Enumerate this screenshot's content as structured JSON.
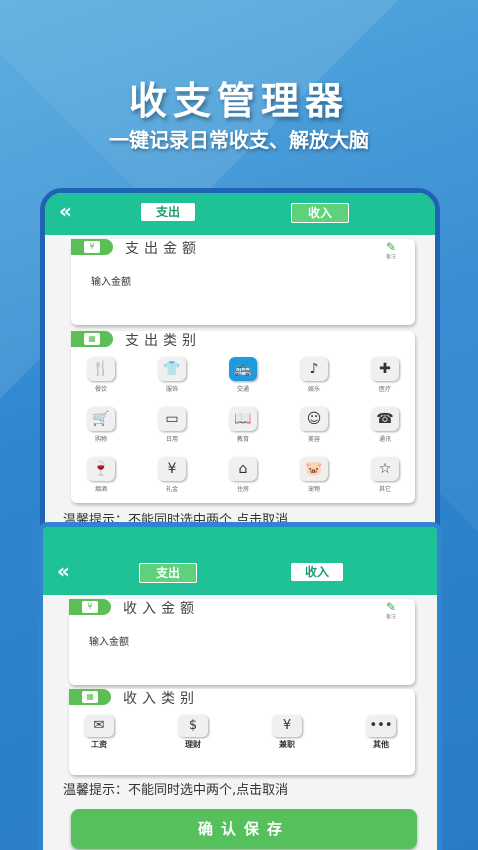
{
  "hero": {
    "title": "收支管理器",
    "subtitle": "一键记录日常收支、解放大脑"
  },
  "screen1": {
    "back": "«",
    "tabs": {
      "expense": "支出",
      "income": "收入"
    },
    "amount_title": "支出金额",
    "note_label": "备注",
    "amount_placeholder": "输入金额",
    "category_title": "支出类别",
    "categories": [
      {
        "label": "餐饮",
        "icon": "utensils-icon",
        "glyph": "🍴"
      },
      {
        "label": "服饰",
        "icon": "shirt-icon",
        "glyph": "👕"
      },
      {
        "label": "交通",
        "icon": "bus-icon",
        "glyph": "🚌",
        "active": true
      },
      {
        "label": "娱乐",
        "icon": "music-icon",
        "glyph": "♪"
      },
      {
        "label": "医疗",
        "icon": "medkit-icon",
        "glyph": "✚"
      },
      {
        "label": "购物",
        "icon": "cart-icon",
        "glyph": "🛒"
      },
      {
        "label": "日用",
        "icon": "sofa-icon",
        "glyph": "▭"
      },
      {
        "label": "教育",
        "icon": "book-icon",
        "glyph": "📖"
      },
      {
        "label": "美容",
        "icon": "face-icon",
        "glyph": "☺"
      },
      {
        "label": "通讯",
        "icon": "phone-icon",
        "glyph": "☎"
      },
      {
        "label": "烟酒",
        "icon": "bottle-icon",
        "glyph": "🍷"
      },
      {
        "label": "礼金",
        "icon": "moneybag-icon",
        "glyph": "¥"
      },
      {
        "label": "住房",
        "icon": "house-icon",
        "glyph": "⌂"
      },
      {
        "label": "宠物",
        "icon": "pet-icon",
        "glyph": "🐷"
      },
      {
        "label": "其它",
        "icon": "star-icon",
        "glyph": "☆"
      }
    ],
    "tip": "温馨提示：不能同时选中两个,点击取消"
  },
  "screen2": {
    "back": "«",
    "tabs": {
      "expense": "支出",
      "income": "收入"
    },
    "amount_title": "收入金额",
    "note_label": "备注",
    "amount_placeholder": "输入金额",
    "category_title": "收入类别",
    "categories": [
      {
        "label": "工资",
        "icon": "wallet-icon",
        "glyph": "✉"
      },
      {
        "label": "理财",
        "icon": "hand-money-icon",
        "glyph": "$"
      },
      {
        "label": "兼职",
        "icon": "moneybag-icon",
        "glyph": "¥"
      },
      {
        "label": "其他",
        "icon": "more-icon",
        "glyph": "•••"
      }
    ],
    "tip": "温馨提示：不能同时选中两个,点击取消",
    "confirm": "确认保存"
  }
}
